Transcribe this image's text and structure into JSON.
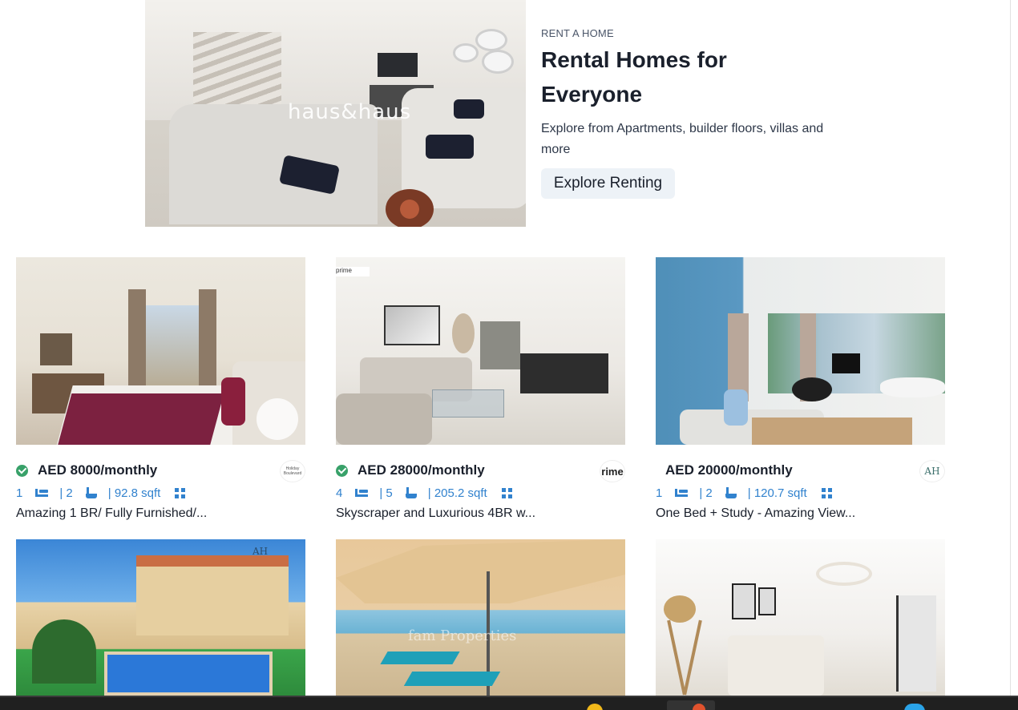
{
  "hero": {
    "eyebrow": "RENT A HOME",
    "title": "Rental Homes for Everyone",
    "description": "Explore from Apartments, builder floors, villas and more",
    "button_label": "Explore Renting",
    "image_watermark": "haus&haus"
  },
  "listings": [
    {
      "price": "AED 8000/monthly",
      "verified": true,
      "beds": "1",
      "baths": "| 2",
      "area": "| 92.8 sqft",
      "title": "Amazing 1 BR/ Fully Furnished/...",
      "agency": "Holiday Boulevard"
    },
    {
      "price": "AED 28000/monthly",
      "verified": true,
      "beds": "4",
      "baths": "| 5",
      "area": "| 205.2 sqft",
      "title": "Skyscraper and Luxurious 4BR w...",
      "agency": "rime"
    },
    {
      "price": "AED 20000/monthly",
      "verified": false,
      "beds": "1",
      "baths": "| 2",
      "area": "| 120.7 sqft",
      "title": "One Bed + Study - Amazing View...",
      "agency": "AH"
    },
    {
      "photo_watermark": "AH"
    },
    {
      "photo_watermark": "fam Properties"
    },
    {}
  ],
  "colors": {
    "accent_blue": "#3182ce",
    "verified_green": "#38a169",
    "button_bg": "#edf2f7",
    "text_dark": "#1a202c"
  }
}
